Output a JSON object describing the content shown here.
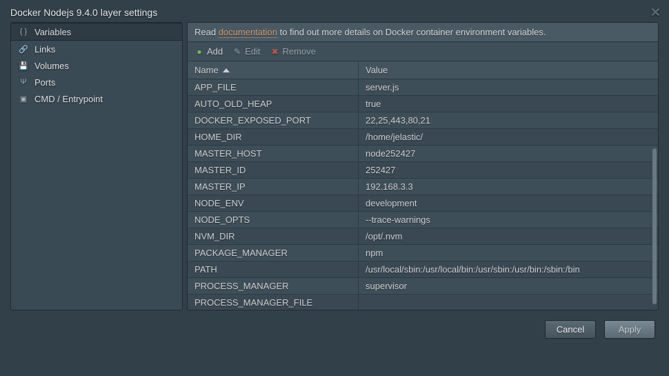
{
  "dialog": {
    "title": "Docker Nodejs 9.4.0 layer settings"
  },
  "sidebar": {
    "items": [
      {
        "label": "Variables",
        "icon": "braces-icon"
      },
      {
        "label": "Links",
        "icon": "link-icon"
      },
      {
        "label": "Volumes",
        "icon": "disk-icon"
      },
      {
        "label": "Ports",
        "icon": "usb-icon"
      },
      {
        "label": "CMD / Entrypoint",
        "icon": "cmd-icon"
      }
    ]
  },
  "info": {
    "prefix": "Read ",
    "link": "documentation",
    "suffix": " to find out more details on Docker container environment variables."
  },
  "toolbar": {
    "add": "Add",
    "edit": "Edit",
    "remove": "Remove"
  },
  "table": {
    "header_name": "Name",
    "header_value": "Value",
    "rows": [
      {
        "name": "APP_FILE",
        "value": "server.js"
      },
      {
        "name": "AUTO_OLD_HEAP",
        "value": "true"
      },
      {
        "name": "DOCKER_EXPOSED_PORT",
        "value": "22,25,443,80,21"
      },
      {
        "name": "HOME_DIR",
        "value": "/home/jelastic/"
      },
      {
        "name": "MASTER_HOST",
        "value": "node252427"
      },
      {
        "name": "MASTER_ID",
        "value": "252427"
      },
      {
        "name": "MASTER_IP",
        "value": "192.168.3.3"
      },
      {
        "name": "NODE_ENV",
        "value": "development"
      },
      {
        "name": "NODE_OPTS",
        "value": "--trace-warnings"
      },
      {
        "name": "NVM_DIR",
        "value": "/opt/.nvm"
      },
      {
        "name": "PACKAGE_MANAGER",
        "value": "npm"
      },
      {
        "name": "PATH",
        "value": "/usr/local/sbin:/usr/local/bin:/usr/sbin:/usr/bin:/sbin:/bin"
      },
      {
        "name": "PROCESS_MANAGER",
        "value": "supervisor"
      },
      {
        "name": "PROCESS_MANAGER_FILE",
        "value": ""
      }
    ]
  },
  "footer": {
    "cancel": "Cancel",
    "apply": "Apply"
  }
}
